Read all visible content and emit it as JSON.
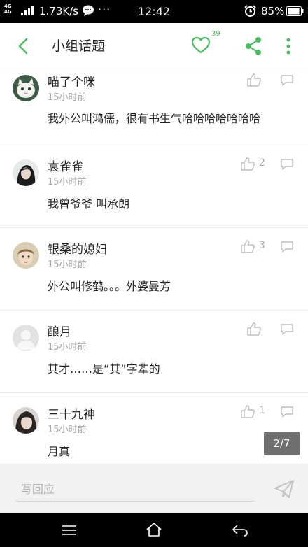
{
  "statusbar": {
    "network": "4G",
    "speed": "1.73K/s",
    "dots": "···",
    "time": "12:42",
    "battery": "85%"
  },
  "header": {
    "title": "小组话题",
    "like_count": "39",
    "accent": "#4cba62"
  },
  "comments": [
    {
      "name": "喵了个咪",
      "time": "15小时前",
      "text": "我外公叫鸿儒，很有书生气哈哈哈哈哈哈哈",
      "likes": "",
      "avatar": "cat-avatar"
    },
    {
      "name": "袁雀雀",
      "time": "15小时前",
      "text": "我曾爷爷 叫承朗",
      "likes": "2",
      "avatar": "girl-avatar"
    },
    {
      "name": "银桑的媳妇",
      "time": "15小时前",
      "text": "外公叫修鹤。。。外婆曼芳",
      "likes": "3",
      "avatar": "anime-avatar"
    },
    {
      "name": "酿月",
      "time": "15小时前",
      "text": "其才……是“其”字辈的",
      "likes": "",
      "avatar": "default-avatar"
    },
    {
      "name": "三十九神",
      "time": "15小时前",
      "text": "月真",
      "likes": "1",
      "avatar": "portrait-avatar"
    }
  ],
  "pager": "2/7",
  "reply_bar": {
    "placeholder": "写回应"
  }
}
